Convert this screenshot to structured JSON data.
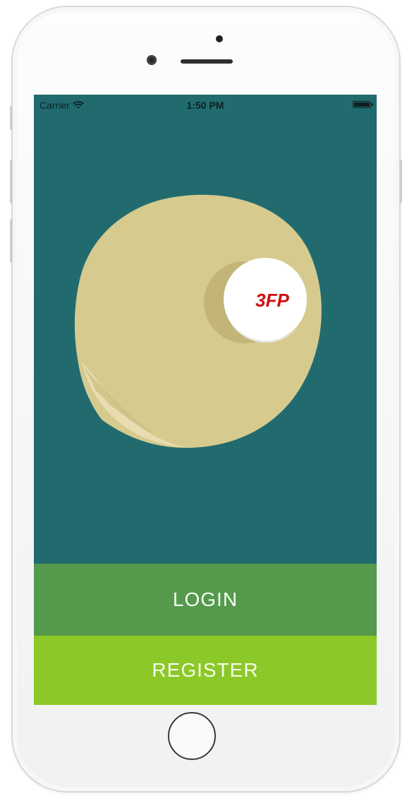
{
  "status_bar": {
    "carrier": "Carrier",
    "time": "1:50 PM",
    "battery_level": 1.0
  },
  "logo": {
    "text": "3FP",
    "text_color": "#d01010",
    "paddle_color": "#d6ca8f",
    "ball_color": "#ffffff"
  },
  "buttons": {
    "login_label": "LOGIN",
    "register_label": "REGISTER"
  },
  "colors": {
    "background": "#216b6f",
    "login": "#559a4c",
    "register": "#8cc828"
  },
  "icons": {
    "wifi": "wifi-icon",
    "battery": "battery-icon"
  }
}
